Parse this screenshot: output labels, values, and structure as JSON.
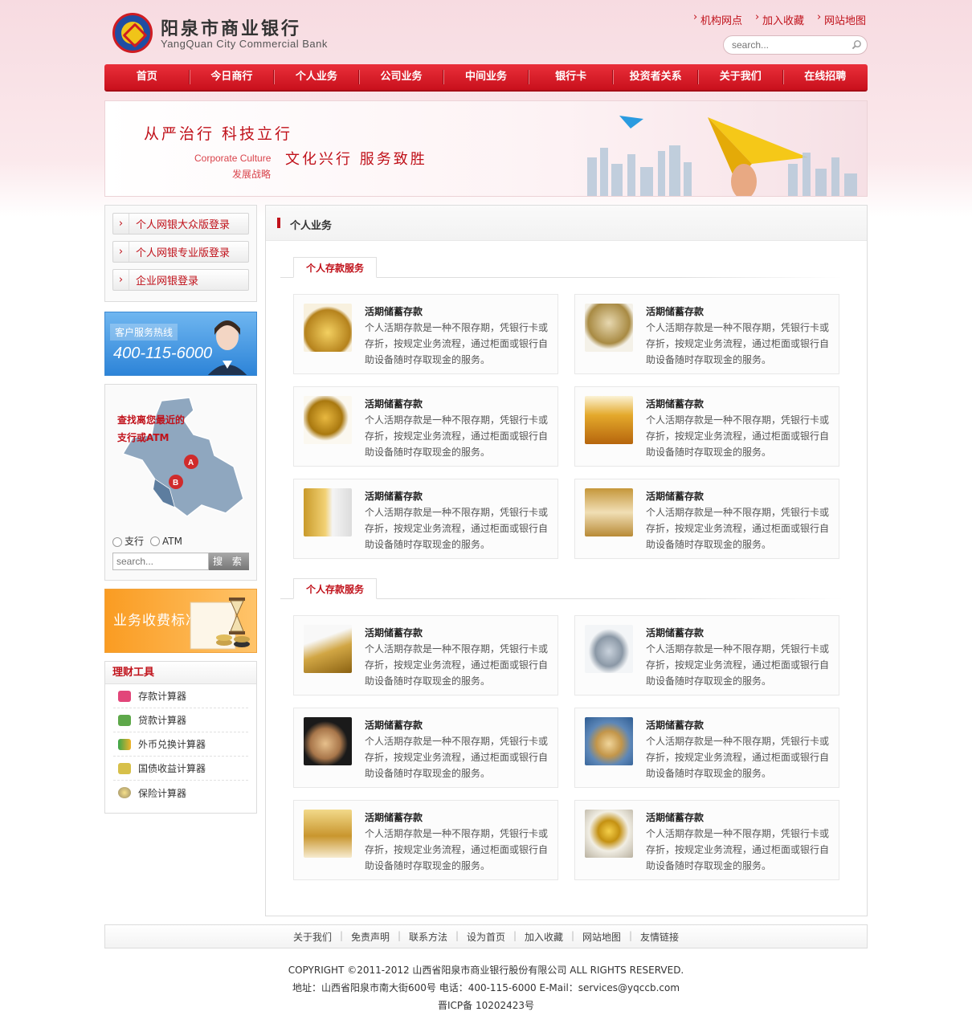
{
  "header": {
    "bank_name_cn": "阳泉市商业银行",
    "bank_name_en": "YangQuan City Commercial Bank",
    "top_links": [
      "机构网点",
      "加入收藏",
      "网站地图"
    ],
    "search_placeholder": "search..."
  },
  "nav": [
    "首页",
    "今日商行",
    "个人业务",
    "公司业务",
    "中间业务",
    "银行卡",
    "投资者关系",
    "关于我们",
    "在线招聘"
  ],
  "banner": {
    "slogan1": "从严治行  科技立行",
    "slogan2": "文化兴行  服务致胜",
    "en": "Corporate Culture",
    "cn": "发展战略"
  },
  "sidebar": {
    "logins": [
      "个人网银大众版登录",
      "个人网银专业版登录",
      "企业网银登录"
    ],
    "hotline": {
      "label": "客户服务热线",
      "number": "400-115-6000"
    },
    "finder": {
      "line1": "查找离您最近的",
      "line2": "支行或ATM",
      "radio1": "支行",
      "radio2": "ATM",
      "placeholder": "search...",
      "button": "搜 索"
    },
    "fee": "业务收费标准",
    "tools": {
      "title": "理财工具",
      "items": [
        "存款计算器",
        "贷款计算器",
        "外币兑换计算器",
        "国债收益计算器",
        "保险计算器"
      ]
    }
  },
  "main": {
    "title": "个人业务",
    "section_tabs": [
      "个人存款服务",
      "个人存款服务"
    ],
    "card_title": "活期储蓄存款",
    "card_desc": "个人活期存款是一种不限存期，凭银行卡或存折，按规定业务流程，通过柜面或银行自助设备随时存取现金的服务。"
  },
  "footer": {
    "links": [
      "关于我们",
      "免责声明",
      "联系方法",
      "设为首页",
      "加入收藏",
      "网站地图",
      "友情链接"
    ],
    "copyright": "COPYRIGHT ©2011-2012   山西省阳泉市商业银行股份有限公司    ALL RIGHTS RESERVED.",
    "address": "地址：山西省阳泉市南大街600号   电话：400-115-6000    E-Mail：services@yqccb.com",
    "icp": "晋ICP备 10202423号"
  },
  "colors": {
    "brand_red": "#c0111a",
    "hotline_blue": "#2d84d8",
    "fee_orange": "#fa9c22"
  }
}
